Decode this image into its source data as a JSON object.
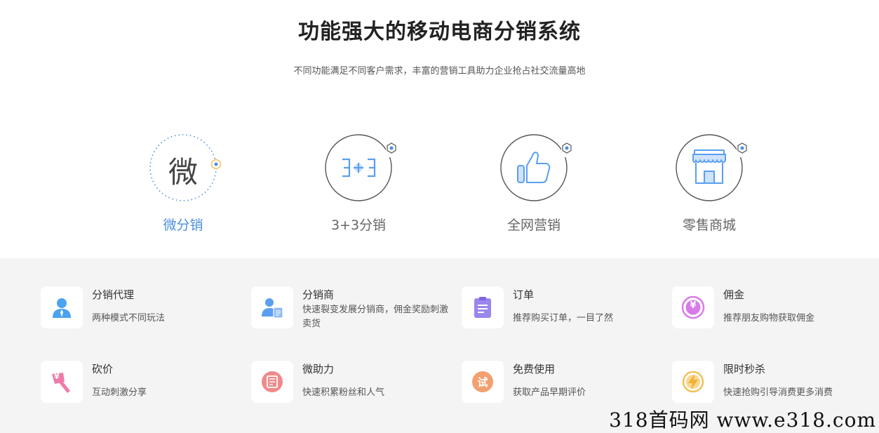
{
  "header": {
    "title": "功能强大的移动电商分销系统",
    "subtitle": "不同功能满足不同客户需求，丰富的营销工具助力企业抢占社交流量高地"
  },
  "modes": [
    {
      "label": "微分销",
      "icon": "wei-character-icon",
      "glyph": "微",
      "active": true
    },
    {
      "label": "3+3分销",
      "icon": "three-plus-three-icon",
      "active": false
    },
    {
      "label": "全网营销",
      "icon": "thumbs-up-icon",
      "active": false
    },
    {
      "label": "零售商城",
      "icon": "storefront-icon",
      "active": false
    }
  ],
  "features": [
    {
      "title": "分销代理",
      "desc": "两种模式不同玩法",
      "icon": "agent-person-icon",
      "color": "#4aa3f0"
    },
    {
      "title": "分销商",
      "desc": "快速裂变发展分销商，佣金奖励刺激卖货",
      "icon": "distributor-card-icon",
      "color": "#5a9ff0"
    },
    {
      "title": "订单",
      "desc": "推荐购买订单，一目了然",
      "icon": "order-clipboard-icon",
      "color": "#9b86ee"
    },
    {
      "title": "佣金",
      "desc": "推荐朋友购物获取佣金",
      "icon": "yen-coin-icon",
      "color": "#d77be8",
      "glyph": "¥"
    },
    {
      "title": "砍价",
      "desc": "互动刺激分享",
      "icon": "axe-yen-icon",
      "color": "#f07aa8",
      "glyph": "¥"
    },
    {
      "title": "微助力",
      "desc": "快速积累粉丝和人气",
      "icon": "boost-document-icon",
      "color": "#f08a8a"
    },
    {
      "title": "免费使用",
      "desc": "获取产品早期评价",
      "icon": "trial-badge-icon",
      "color": "#f3a070",
      "glyph": "试"
    },
    {
      "title": "限时秒杀",
      "desc": "快速抢购引导消费更多消费",
      "icon": "lightning-bolt-icon",
      "color": "#f4c056"
    }
  ],
  "watermark": "318首码网  www.e318.com"
}
